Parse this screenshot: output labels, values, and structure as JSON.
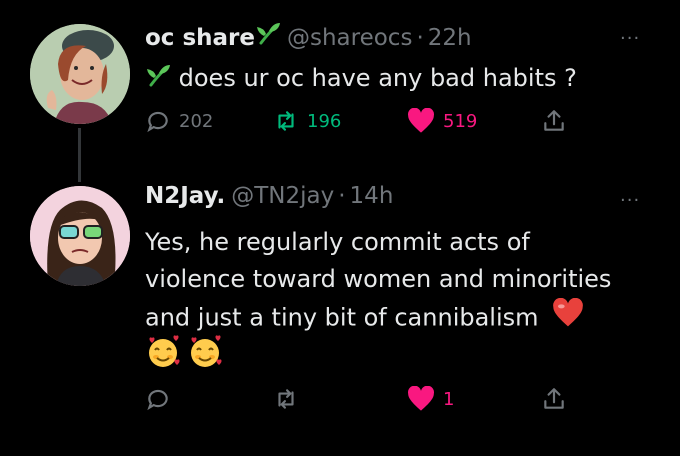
{
  "tweet1": {
    "name": "oc share",
    "handle": "@shareocs",
    "dot": "·",
    "time": "22h",
    "text": "does ur oc have any bad habits ?",
    "replies": "202",
    "retweets": "196",
    "likes": "519",
    "more": "···"
  },
  "tweet2": {
    "name": "N2Jay.",
    "handle": "@TN2jay",
    "dot": "·",
    "time": "14h",
    "line1": "Yes, he regularly commit acts of",
    "line2": "violence toward women and minorities",
    "line3": "and just a tiny bit of cannibalism",
    "likes": "1",
    "more": "···"
  },
  "colors": {
    "background": "#000000",
    "text": "#e7e9ea",
    "muted": "#71767b",
    "retweet_green": "#00ba7c",
    "like_pink": "#f91880"
  },
  "icons": [
    "sprout-icon",
    "reply-icon",
    "retweet-icon",
    "heart-icon",
    "share-icon",
    "red-heart-emoji",
    "smiling-face-with-hearts-emoji"
  ]
}
